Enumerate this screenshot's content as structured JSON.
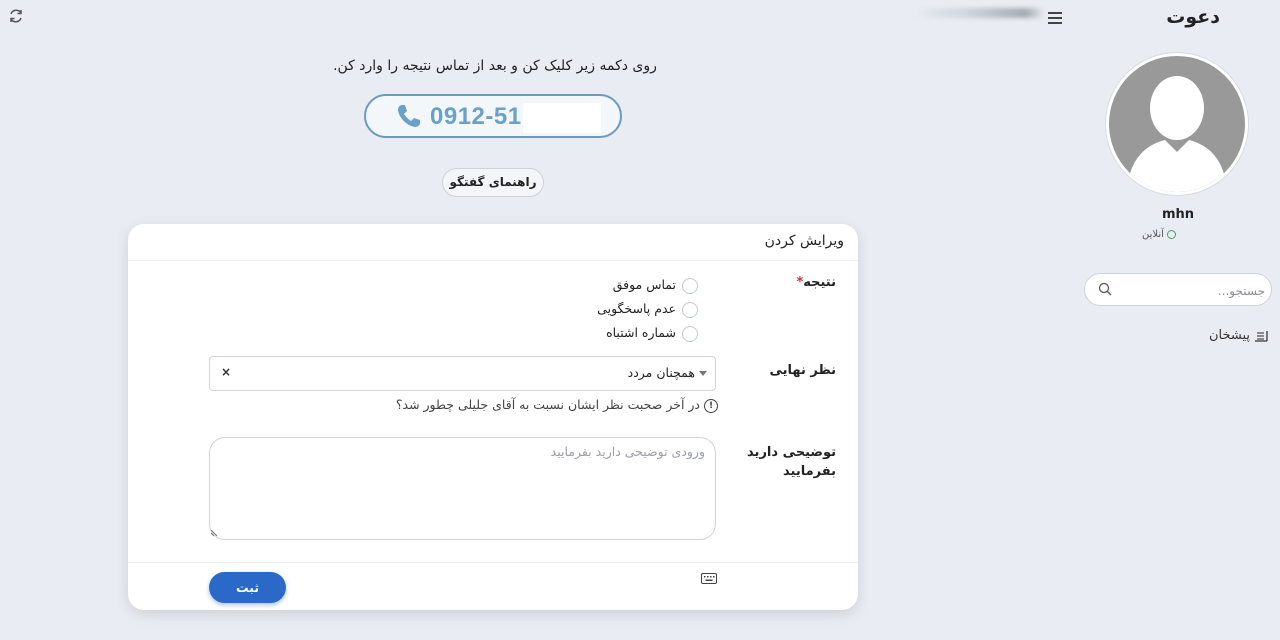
{
  "header": {
    "brand": "دعوت"
  },
  "sidebar": {
    "username": "mhn",
    "status": "آنلاین",
    "search_placeholder": "جستجو...",
    "nav_item": "پیشخان"
  },
  "call": {
    "instruction": "روی دکمه زیر کلیک کن و بعد از تماس نتیجه را وارد کن.",
    "phone_number": "0912-51",
    "guide_label": "راهنمای گفتگو"
  },
  "form": {
    "title": "ویرایش کردن",
    "result_label": "نتیجه",
    "required_mark": "*",
    "result_options": [
      "تماس موفق",
      "عدم پاسخگویی",
      "شماره اشتباه"
    ],
    "final_opinion_label": "نظر نهایی",
    "final_opinion_value": "همچنان مردد",
    "clear_symbol": "×",
    "help_text": "در آخر صحبت نظر ایشان نسبت به آقای جلیلی چطور شد؟",
    "description_label": "توضیحی دارید بفرمایید",
    "description_placeholder": "ورودی توضیحی دارید بفرمایید",
    "submit_label": "ثبت"
  },
  "colors": {
    "accent": "#2b69c8",
    "phone": "#6aa1c9",
    "online": "#3aa653",
    "required": "#d9302c"
  }
}
